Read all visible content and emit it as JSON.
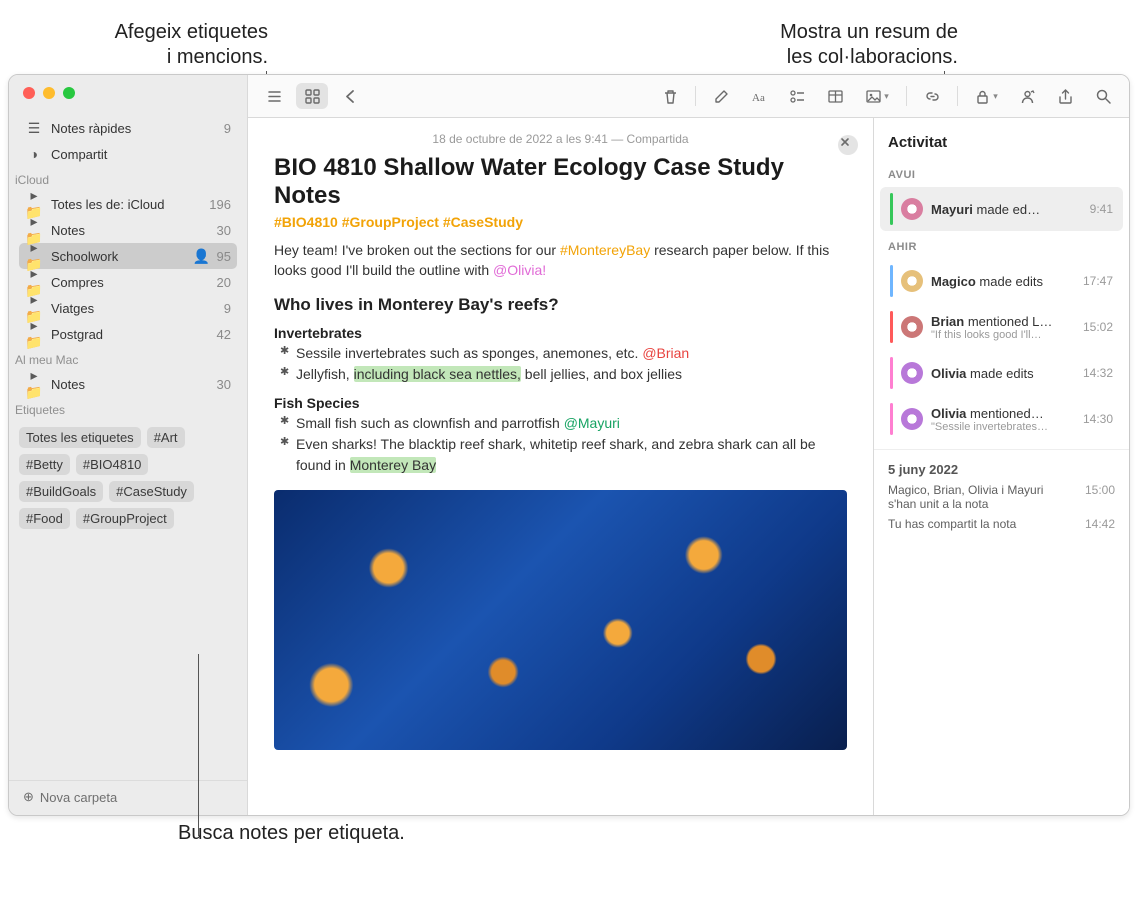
{
  "callouts": {
    "topLeft": "Afegeix etiquetes\ni mencions.",
    "topRight": "Mostra un resum de\nles col·laboracions.",
    "bottom": "Busca notes per etiqueta."
  },
  "sidebar": {
    "quickNotes": {
      "label": "Notes ràpides",
      "count": "9"
    },
    "shared": {
      "label": "Compartit"
    },
    "section1": "iCloud",
    "items1": [
      {
        "label": "Totes les de: iCloud",
        "count": "196"
      },
      {
        "label": "Notes",
        "count": "30"
      },
      {
        "label": "Schoolwork",
        "count": "95",
        "shared": true,
        "selected": true
      },
      {
        "label": "Compres",
        "count": "20"
      },
      {
        "label": "Viatges",
        "count": "9"
      },
      {
        "label": "Postgrad",
        "count": "42"
      }
    ],
    "section2": "Al meu Mac",
    "items2": [
      {
        "label": "Notes",
        "count": "30"
      }
    ],
    "section3": "Etiquetes",
    "tags": [
      "Totes les etiquetes",
      "#Art",
      "#Betty",
      "#BIO4810",
      "#BuildGoals",
      "#CaseStudy",
      "#Food",
      "#GroupProject"
    ],
    "newFolder": "Nova carpeta"
  },
  "note": {
    "meta": "18 de octubre de 2022 a les 9:41 — Compartida",
    "title": "BIO 4810 Shallow Water Ecology Case Study Notes",
    "tags": "#BIO4810 #GroupProject #CaseStudy",
    "intro_a": "Hey team! I've broken out the sections for our ",
    "intro_tag": "#MontereyBay",
    "intro_b": " research paper below. If this looks good I'll build the outline with ",
    "intro_mention": "@Olivia!",
    "h1": "Who lives in Monterey Bay's reefs?",
    "h_inv": "Invertebrates",
    "inv1_a": "Sessile invertebrates such as sponges, anemones, etc. ",
    "inv1_m": "@Brian",
    "inv2_a": "Jellyfish, ",
    "inv2_hl": "including black sea nettles,",
    "inv2_b": " bell jellies, and box jellies",
    "h_fish": "Fish Species",
    "fish1_a": "Small fish such as clownfish and parrotfish ",
    "fish1_m": "@Mayuri",
    "fish2_a": "Even sharks! The blacktip reef shark, whitetip reef shark, and zebra shark can all be found in ",
    "fish2_hl": "Monterey Bay"
  },
  "activity": {
    "title": "Activitat",
    "sections": [
      {
        "head": "AVUI",
        "items": [
          {
            "bar": "#36c75a",
            "av": "#d97ea0",
            "text": "<b>Mayuri</b> made ed…",
            "time": "9:41",
            "sel": true
          }
        ]
      },
      {
        "head": "AHIR",
        "items": [
          {
            "bar": "#6fb6ff",
            "av": "#e6c07a",
            "text": "<b>Magico</b> made edits",
            "time": "17:47"
          },
          {
            "bar": "#ff5a5a",
            "av": "#c77",
            "text": "<b>Brian</b> mentioned L…",
            "sub": "\"If this looks good I'll…",
            "time": "15:02"
          },
          {
            "bar": "#ff7fd1",
            "av": "#b878d9",
            "text": "<b>Olivia</b> made edits",
            "time": "14:32"
          },
          {
            "bar": "#ff7fd1",
            "av": "#b878d9",
            "text": "<b>Olivia</b> mentioned…",
            "sub": "\"Sessile invertebrates…",
            "time": "14:30"
          }
        ]
      }
    ],
    "logDate": "5 juny 2022",
    "log": [
      {
        "txt": "Magico, Brian, Olivia i Mayuri s'han unit a la nota",
        "time": "15:00"
      },
      {
        "txt": "Tu has compartit la nota",
        "time": "14:42"
      }
    ]
  }
}
